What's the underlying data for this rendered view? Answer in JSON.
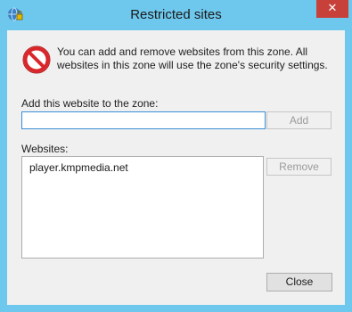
{
  "window": {
    "title": "Restricted sites",
    "close_glyph": "✕",
    "icon": "security-zone-icon"
  },
  "info": {
    "icon": "restricted-icon",
    "text": "You can add and remove websites from this zone. All websites in this zone will use the zone's security settings."
  },
  "add": {
    "label": "Add this website to the zone:",
    "value": "",
    "button": "Add"
  },
  "websites": {
    "label": "Websites:",
    "items": [
      "player.kmpmedia.net"
    ],
    "remove_button": "Remove"
  },
  "footer": {
    "close_button": "Close"
  },
  "colors": {
    "titlebar": "#6ec8ed",
    "close": "#c7413a",
    "restricted_red": "#d9262a"
  }
}
